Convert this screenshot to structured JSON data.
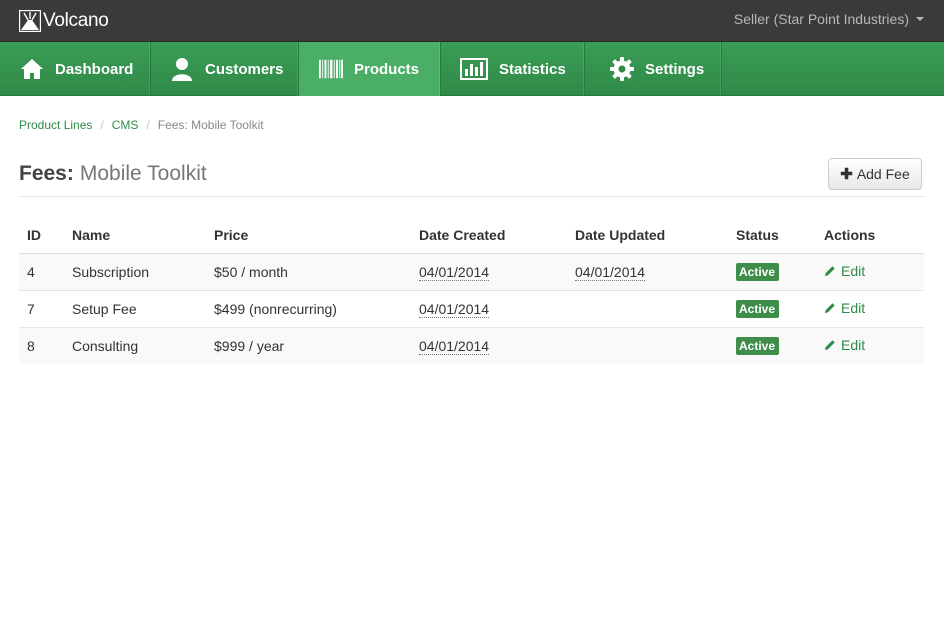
{
  "brand": {
    "name": "Volcano"
  },
  "account": {
    "label": "Seller (Star Point Industries)"
  },
  "nav": {
    "items": [
      {
        "label": "Dashboard",
        "icon": "home-icon"
      },
      {
        "label": "Customers",
        "icon": "user-icon"
      },
      {
        "label": "Products",
        "icon": "barcode-icon"
      },
      {
        "label": "Statistics",
        "icon": "bar-chart-icon"
      },
      {
        "label": "Settings",
        "icon": "gear-icon"
      }
    ],
    "active": "Products"
  },
  "breadcrumb": {
    "items": [
      "Product Lines",
      "CMS"
    ],
    "separator": "/",
    "current": "Fees: Mobile Toolkit"
  },
  "page": {
    "title": "Fees:",
    "subtitle": "Mobile Toolkit",
    "add_button": "Add Fee"
  },
  "table": {
    "headers": [
      "ID",
      "Name",
      "Price",
      "Date Created",
      "Date Updated",
      "Status",
      "Actions"
    ],
    "rows": [
      {
        "id": "4",
        "name": "Subscription",
        "price": "$50 / month",
        "created": "04/01/2014",
        "updated": "04/01/2014",
        "status": "Active",
        "action": "Edit"
      },
      {
        "id": "7",
        "name": "Setup Fee",
        "price": "$499 (nonrecurring)",
        "created": "04/01/2014",
        "updated": "",
        "status": "Active",
        "action": "Edit"
      },
      {
        "id": "8",
        "name": "Consulting",
        "price": "$999 / year",
        "created": "04/01/2014",
        "updated": "",
        "status": "Active",
        "action": "Edit"
      }
    ]
  },
  "colors": {
    "nav_green": "#2f8a48",
    "active_green": "#4aae67",
    "link_green": "#2e8b48",
    "badge_green": "#3e8e4a",
    "topbar": "#3a3a3a"
  }
}
